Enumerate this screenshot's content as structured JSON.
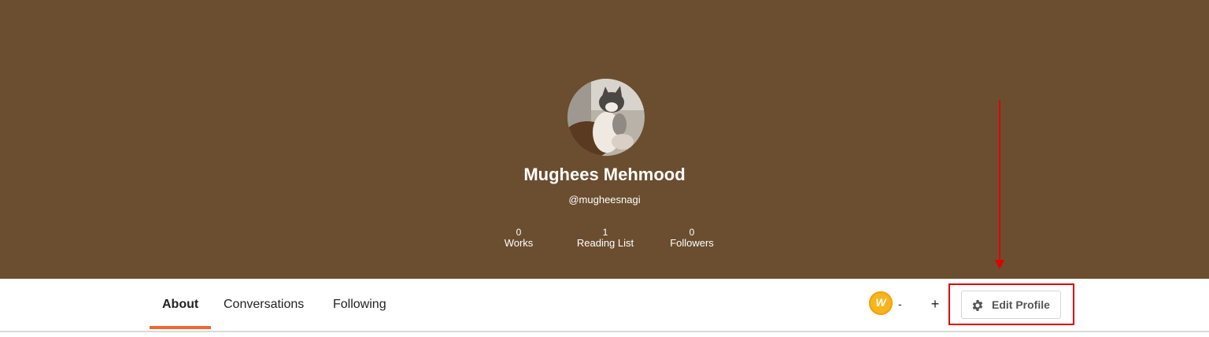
{
  "profile": {
    "display_name": "Mughees Mehmood",
    "username": "@mugheesnagi",
    "avatar_icon": "cat-photo-avatar"
  },
  "stats": [
    {
      "value": "0",
      "label": "Works"
    },
    {
      "value": "1",
      "label": "Reading List"
    },
    {
      "value": "0",
      "label": "Followers"
    }
  ],
  "tabs": [
    {
      "label": "About",
      "active": true
    },
    {
      "label": "Conversations",
      "active": false
    },
    {
      "label": "Following",
      "active": false
    }
  ],
  "coins": {
    "icon": "wattpad-coin-icon",
    "letter": "W",
    "count": "-",
    "add_label": "+"
  },
  "edit_profile": {
    "label": "Edit Profile",
    "icon": "gear-icon"
  },
  "annotation": {
    "color": "#e00000"
  },
  "colors": {
    "hero_background": "#6a4e2f",
    "active_tab_underline": "#f0682e",
    "coin": "#f7b51b"
  }
}
